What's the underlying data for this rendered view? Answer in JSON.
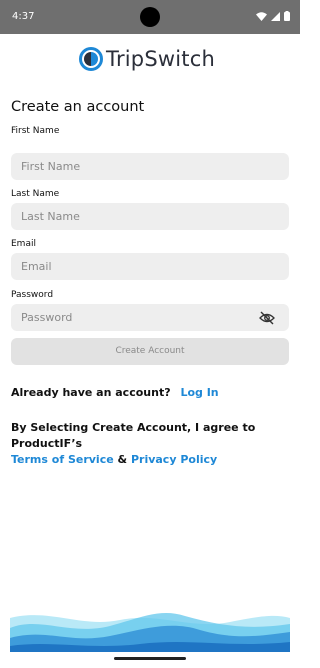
{
  "status_bar": {
    "time": "4:37"
  },
  "brand": {
    "name": "TripSwitch",
    "accent": "#1e88d6"
  },
  "page": {
    "heading": "Create an account"
  },
  "form": {
    "first_name": {
      "label": "First Name",
      "placeholder": "First Name"
    },
    "last_name": {
      "label": "Last Name",
      "placeholder": "Last Name"
    },
    "email": {
      "label": "Email",
      "placeholder": "Email"
    },
    "password": {
      "label": "Password",
      "placeholder": "Password"
    },
    "submit_label": "Create Account"
  },
  "signin": {
    "prompt": "Already have an account?",
    "link": "Log In"
  },
  "terms": {
    "text": "By Selecting Create Account, I agree to ProductIF’s",
    "tos": "Terms of Service",
    "and": "&",
    "privacy": "Privacy Policy"
  },
  "icons": {
    "status": [
      "wifi-icon",
      "signal-icon",
      "battery-icon"
    ],
    "password_toggle": "eye-off-icon"
  }
}
